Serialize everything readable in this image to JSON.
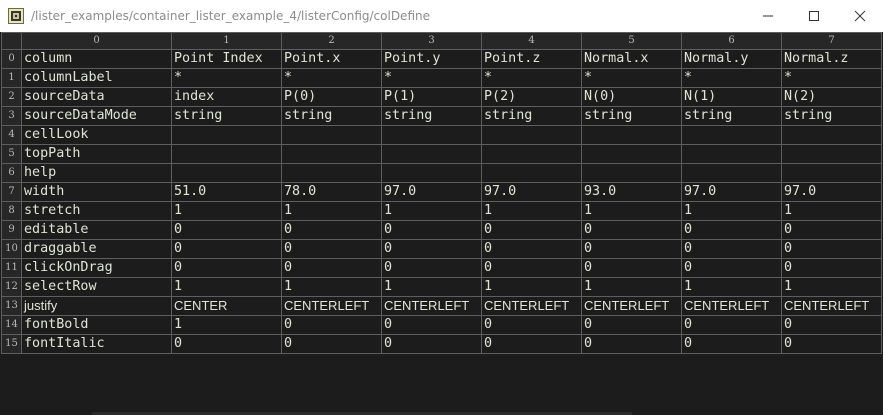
{
  "window": {
    "title": "/lister_examples/container_lister_example_4/listerConfig/colDefine",
    "icon": "app-icon",
    "controls": [
      "minimize-icon",
      "maximize-icon",
      "close-icon"
    ]
  },
  "grid": {
    "column_headers": [
      "0",
      "1",
      "2",
      "3",
      "4",
      "5",
      "6",
      "7"
    ],
    "row_headers": [
      "0",
      "1",
      "2",
      "3",
      "4",
      "5",
      "6",
      "7",
      "8",
      "9",
      "10",
      "11",
      "12",
      "13",
      "14",
      "15"
    ],
    "rows": [
      [
        "column",
        "Point Index",
        "Point.x",
        "Point.y",
        "Point.z",
        "Normal.x",
        "Normal.y",
        "Normal.z"
      ],
      [
        "columnLabel",
        "*",
        "*",
        "*",
        "*",
        "*",
        "*",
        "*"
      ],
      [
        "sourceData",
        "index",
        "P(0)",
        "P(1)",
        "P(2)",
        "N(0)",
        "N(1)",
        "N(2)"
      ],
      [
        "sourceDataMode",
        "string",
        "string",
        "string",
        "string",
        "string",
        "string",
        "string"
      ],
      [
        "cellLook",
        "",
        "",
        "",
        "",
        "",
        "",
        ""
      ],
      [
        "topPath",
        "",
        "",
        "",
        "",
        "",
        "",
        ""
      ],
      [
        "help",
        "",
        "",
        "",
        "",
        "",
        "",
        ""
      ],
      [
        "width",
        "51.0",
        "78.0",
        "97.0",
        "97.0",
        "93.0",
        "97.0",
        "97.0"
      ],
      [
        "stretch",
        "1",
        "1",
        "1",
        "1",
        "1",
        "1",
        "1"
      ],
      [
        "editable",
        "0",
        "0",
        "0",
        "0",
        "0",
        "0",
        "0"
      ],
      [
        "draggable",
        "0",
        "0",
        "0",
        "0",
        "0",
        "0",
        "0"
      ],
      [
        "clickOnDrag",
        "0",
        "0",
        "0",
        "0",
        "0",
        "0",
        "0"
      ],
      [
        "selectRow",
        "1",
        "1",
        "1",
        "1",
        "1",
        "1",
        "1"
      ],
      [
        "justify",
        "CENTER",
        "CENTERLEFT",
        "CENTERLEFT",
        "CENTERLEFT",
        "CENTERLEFT",
        "CENTERLEFT",
        "CENTERLEFT"
      ],
      [
        "fontBold",
        "1",
        "0",
        "0",
        "0",
        "0",
        "0",
        "0"
      ],
      [
        "fontItalic",
        "0",
        "0",
        "0",
        "0",
        "0",
        "0",
        "0"
      ]
    ]
  },
  "colors": {
    "background": "#1c1c1c",
    "header_background": "#272727",
    "grid_line": "#5e5e5e",
    "cell_text": "#dfe4d6",
    "titlebar": "#ffffff"
  }
}
